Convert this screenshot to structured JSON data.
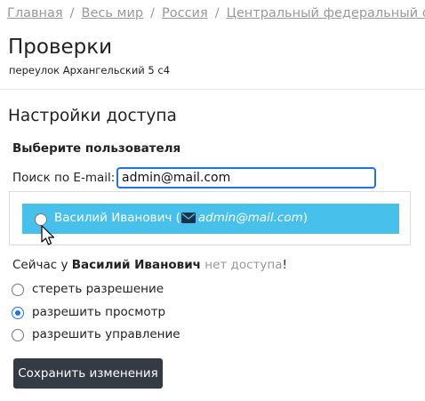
{
  "breadcrumb": {
    "items": [
      "Главная",
      "Весь мир",
      "Россия",
      "Центральный федеральный округ"
    ],
    "separator": "/"
  },
  "page": {
    "title": "Проверки",
    "address": "переулок Архангельский 5 с4"
  },
  "access": {
    "section_title": "Настройки доступа",
    "select_user_label": "Выберите пользователя",
    "search_label": "Поиск по E-mail:",
    "search_value": "admin@mail.com",
    "result": {
      "name": "Василий Иванович",
      "open_paren": "(",
      "email": "admin@mail.com",
      "close_paren": ")",
      "icon": "envelope-icon",
      "highlight_color": "#47c1ec"
    },
    "status": {
      "prefix": "Сейчас у ",
      "user": "Василий Иванович",
      "access_text": "нет доступа",
      "suffix": "!"
    },
    "options": [
      {
        "label": "стереть разрешение",
        "checked": false
      },
      {
        "label": "разрешить просмотр",
        "checked": true
      },
      {
        "label": "разрешить управление",
        "checked": false
      }
    ],
    "save_label": "Сохранить изменения"
  }
}
